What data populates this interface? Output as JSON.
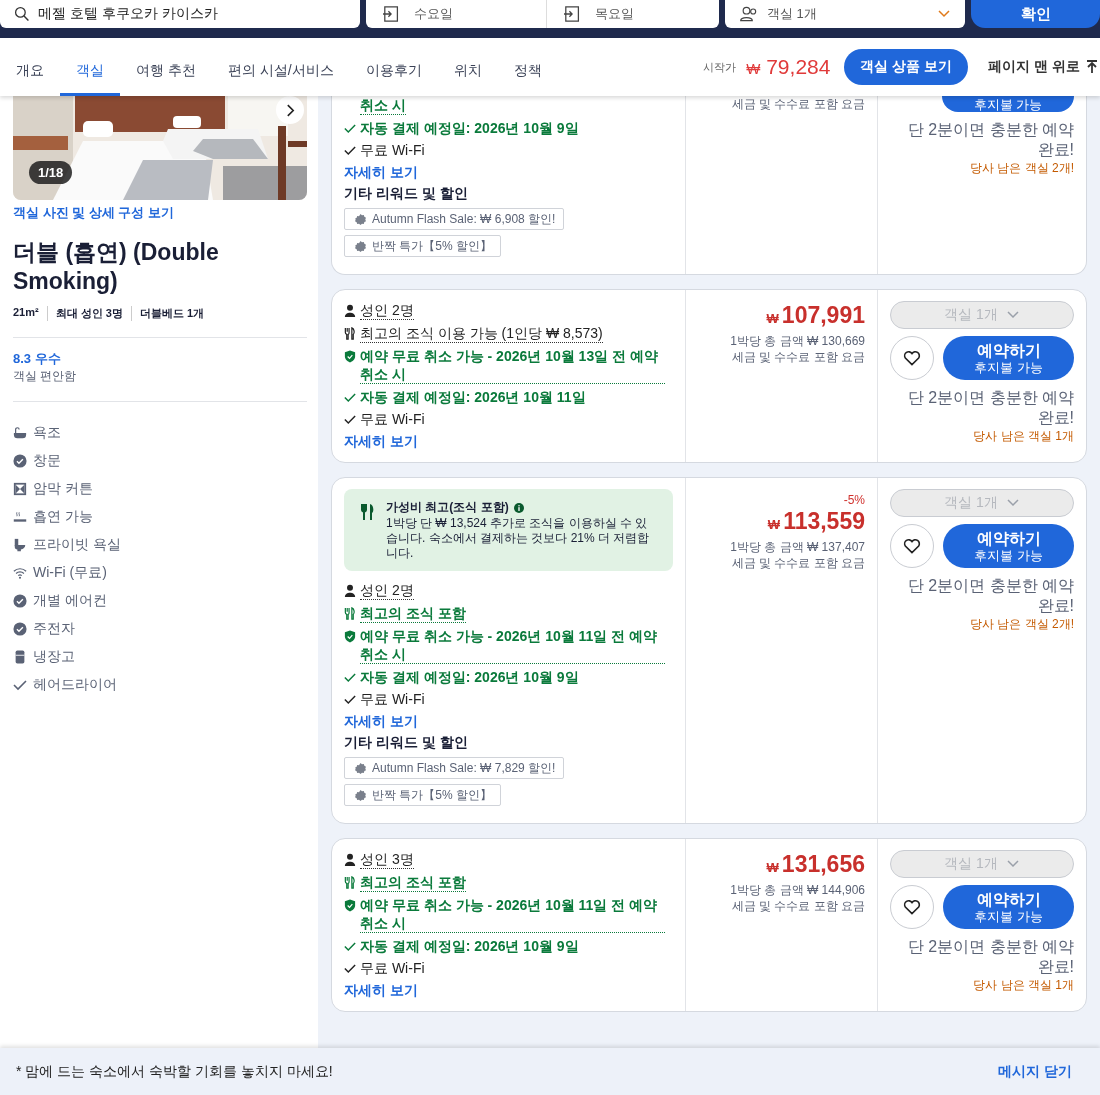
{
  "search_bar": {
    "destination": "메젤 호텔 후쿠오카 카이스카",
    "check_in": "수요일",
    "check_out": "목요일",
    "rooms": "객실 1개",
    "submit": "확인"
  },
  "nav": {
    "tabs": [
      {
        "label": "개요",
        "selected": false
      },
      {
        "label": "객실",
        "selected": true
      },
      {
        "label": "여행 추천",
        "selected": false
      },
      {
        "label": "편의 시설/서비스",
        "selected": false
      },
      {
        "label": "이용후기",
        "selected": false
      },
      {
        "label": "위치",
        "selected": false
      },
      {
        "label": "정책",
        "selected": false
      }
    ],
    "price_label": "시작가",
    "currency": "₩",
    "price": "79,284",
    "rooms_button": "객실 상품 보기",
    "top_link": "페이지 맨 위로"
  },
  "room": {
    "photo": {
      "kind": "picture",
      "counter": "1/18"
    },
    "photos_link": "객실 사진 및 상세 구성 보기",
    "name": "더블 (흡연) (Double Smoking)",
    "specs": [
      "21m²",
      "최대 성인 3명",
      "더블베드 1개"
    ],
    "rating": "8.3 우수",
    "rating_note": "객실 편안함",
    "amenities": [
      {
        "kind": "bath",
        "label": "욕조"
      },
      {
        "kind": "check-circle",
        "label": "창문"
      },
      {
        "kind": "curtain",
        "label": "암막 커튼"
      },
      {
        "kind": "smoking",
        "label": "흡연 가능"
      },
      {
        "kind": "toilet",
        "label": "프라이빗 욕실"
      },
      {
        "kind": "wifi",
        "label": "Wi-Fi (무료)"
      },
      {
        "kind": "check-circle",
        "label": "개별 에어컨"
      },
      {
        "kind": "check-circle",
        "label": "주전자"
      },
      {
        "kind": "fridge",
        "label": "냉장고"
      },
      {
        "kind": "check",
        "label": "헤어드라이어"
      }
    ]
  },
  "offers": [
    {
      "cut_top": true,
      "features": [
        {
          "kind": "continuation",
          "text": "취소 시"
        },
        {
          "kind": "autopay",
          "text": "자동 결제 예정일: 2026년 10월 9일"
        },
        {
          "kind": "wifi",
          "text": "무료 Wi-Fi"
        }
      ],
      "details_link": "자세히 보기",
      "rewards_title": "기타 리워드 및 할인",
      "rewards": [
        "Autumn Flash Sale: ₩ 6,908 할인!",
        "반짝 특가【5% 할인】"
      ],
      "tax_note": "세금 및 수수료 포함 요금",
      "book": {
        "sublabel": "후지불 가능"
      },
      "note": "단 2분이면 충분한 예약 완료!",
      "remaining": "당사 남은 객실 2개!"
    },
    {
      "cut_top": false,
      "features": [
        {
          "kind": "guests",
          "text": "성인 2명"
        },
        {
          "kind": "breakfast",
          "included": false,
          "text": "최고의 조식 이용 가능 (1인당 ₩ 8,573)"
        },
        {
          "kind": "cancel",
          "text": "예약 무료 취소 가능 - 2026년 10월 13일 전 예약 취소 시"
        },
        {
          "kind": "autopay",
          "text": "자동 결제 예정일: 2026년 10월 11일"
        },
        {
          "kind": "wifi",
          "text": "무료 Wi-Fi"
        }
      ],
      "details_link": "자세히 보기",
      "currency": "₩",
      "price": "107,991",
      "total": "1박당 총 금액 ₩ 130,669",
      "tax_note": "세금 및 수수료 포함 요금",
      "room_select": {
        "label": "객실 1개",
        "disabled": true
      },
      "book": {
        "label": "예약하기",
        "sublabel": "후지불 가능"
      },
      "note": "단 2분이면 충분한 예약 완료!",
      "remaining": "당사 남은 객실 1개"
    },
    {
      "cut_top": false,
      "banner": {
        "title": "가성비 최고(조식 포함)",
        "text": "1박당 단 ₩ 13,524 추가로 조식을 이용하실 수 있습니다. 숙소에서 결제하는 것보다 21% 더 저렴합니다."
      },
      "features": [
        {
          "kind": "guests",
          "text": "성인 2명"
        },
        {
          "kind": "breakfast",
          "included": true,
          "text": "최고의 조식 포함"
        },
        {
          "kind": "cancel",
          "text": "예약 무료 취소 가능 - 2026년 10월 11일 전 예약 취소 시"
        },
        {
          "kind": "autopay",
          "text": "자동 결제 예정일: 2026년 10월 9일"
        },
        {
          "kind": "wifi",
          "text": "무료 Wi-Fi"
        }
      ],
      "details_link": "자세히 보기",
      "rewards_title": "기타 리워드 및 할인",
      "rewards": [
        "Autumn Flash Sale: ₩ 7,829 할인!",
        "반짝 특가【5% 할인】"
      ],
      "discount": "-5%",
      "currency": "₩",
      "price": "113,559",
      "total": "1박당 총 금액 ₩ 137,407",
      "tax_note": "세금 및 수수료 포함 요금",
      "room_select": {
        "label": "객실 1개",
        "disabled": true
      },
      "book": {
        "label": "예약하기",
        "sublabel": "후지불 가능"
      },
      "note": "단 2분이면 충분한 예약 완료!",
      "remaining": "당사 남은 객실 2개!"
    },
    {
      "cut_top": false,
      "features": [
        {
          "kind": "guests",
          "text": "성인 3명"
        },
        {
          "kind": "breakfast",
          "included": true,
          "text": "최고의 조식 포함"
        },
        {
          "kind": "cancel",
          "text": "예약 무료 취소 가능 - 2026년 10월 11일 전 예약 취소 시"
        },
        {
          "kind": "autopay",
          "text": "자동 결제 예정일: 2026년 10월 9일"
        },
        {
          "kind": "wifi",
          "text": "무료 Wi-Fi"
        }
      ],
      "details_link": "자세히 보기",
      "currency": "₩",
      "price": "131,656",
      "total": "1박당 총 금액 ₩ 144,906",
      "tax_note": "세금 및 수수료 포함 요금",
      "room_select": {
        "label": "객실 1개",
        "disabled": true
      },
      "book": {
        "label": "예약하기",
        "sublabel": "후지불 가능"
      },
      "note": "단 2분이면 충분한 예약 완료!",
      "remaining": "당사 남은 객실 1개"
    }
  ],
  "footer": {
    "message": "* 맘에 드는 숙소에서 숙박할 기회를 놓치지 마세요!",
    "close": "메시지 닫기"
  }
}
